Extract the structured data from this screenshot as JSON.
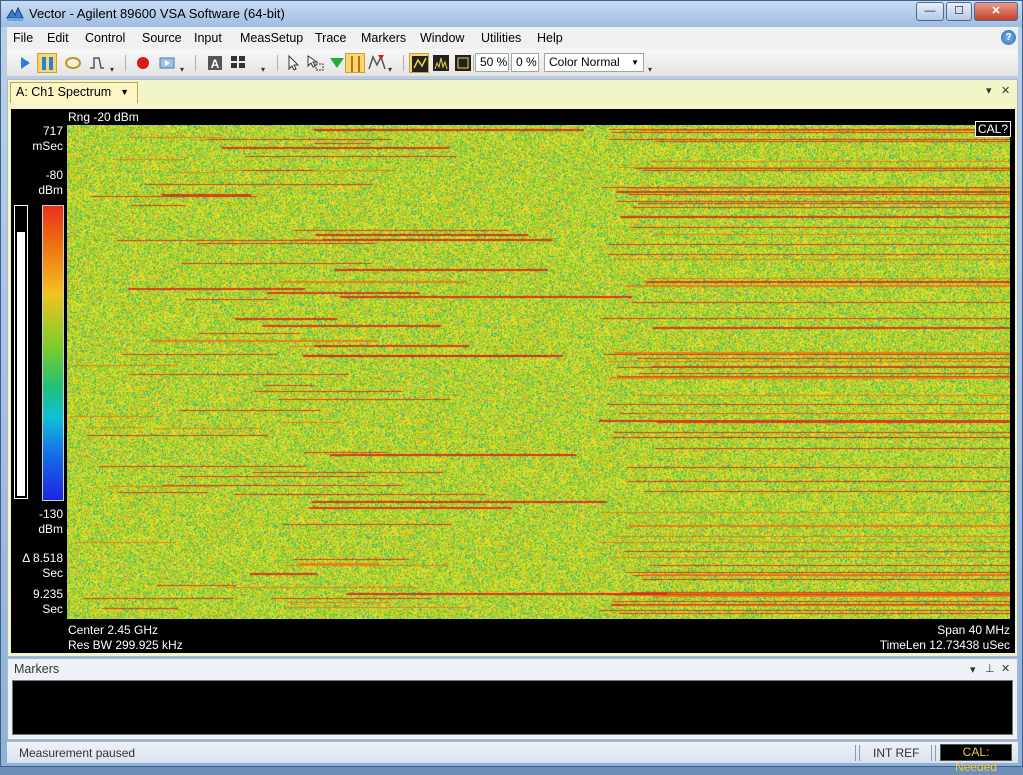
{
  "window": {
    "title": "Vector - Agilent 89600 VSA Software (64-bit)",
    "minimize": "—",
    "maximize": "☐",
    "close": "✕"
  },
  "menu": {
    "items": [
      "File",
      "Edit",
      "Control",
      "Source",
      "Input",
      "MeasSetup",
      "Trace",
      "Markers",
      "Window",
      "Utilities",
      "Help"
    ],
    "help_icon": "?"
  },
  "toolbar": {
    "zoom_a": "50 %",
    "zoom_b": "0 %",
    "color_mode": "Color Normal",
    "icons": [
      "play-icon",
      "pause-icon",
      "loop-icon",
      "trigger-icon",
      "record-icon",
      "playback-icon",
      "annotation-icon",
      "grid-layout-icon",
      "pointer-icon",
      "zoom-pointer-icon",
      "marker-icon",
      "band-marker-icon",
      "peak-marker-icon",
      "trace-view-icon",
      "spectrum-view-icon",
      "spectrogram-view-icon"
    ]
  },
  "trace": {
    "tab_label": "A: Ch1 Spectrum",
    "range": "Rng -20 dBm",
    "cal_flag": "CAL?",
    "y_top": "717",
    "y_top_unit": "mSec",
    "scale_top": "-80",
    "scale_top_unit": "dBm",
    "scale_bottom": "-130",
    "scale_bottom_unit": "dBm",
    "delta": "Δ 8.518",
    "delta_unit": "Sec",
    "y_bottom": "9.235",
    "y_bottom_unit": "Sec",
    "center": "Center 2.45 GHz",
    "span": "Span 40 MHz",
    "res_bw": "Res BW 299.925 kHz",
    "time_len": "TimeLen 12.73438 uSec"
  },
  "markers_panel": {
    "title": "Markers"
  },
  "status": {
    "message": "Measurement paused",
    "int_ref": "INT REF",
    "cal": "CAL: Needed"
  },
  "colors": {
    "accent": "#f3c93a",
    "spectro_green": "#7ccc2a",
    "spectro_red": "#e8321c",
    "spectro_yellow": "#f2c320"
  }
}
